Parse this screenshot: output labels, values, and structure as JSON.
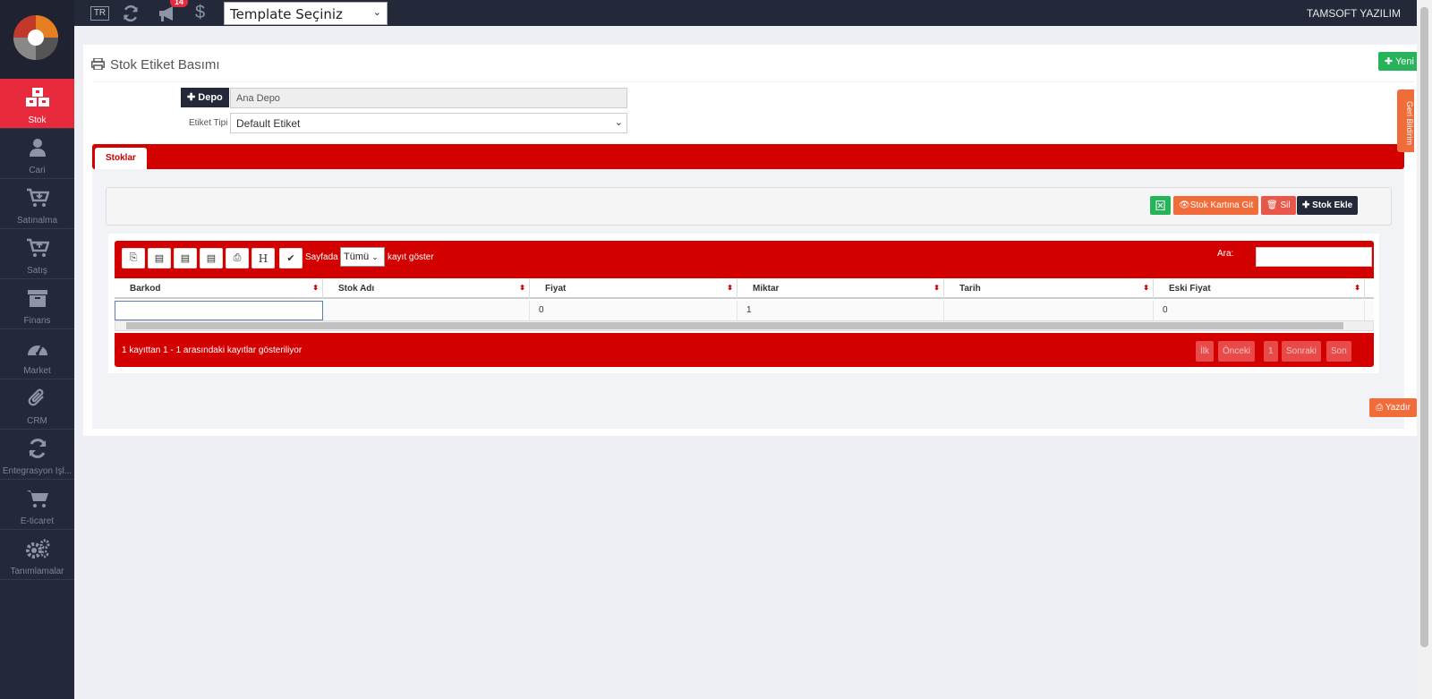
{
  "topbar": {
    "lang": "TR",
    "notification_count": "14",
    "template_select": "Template Seçiniz",
    "company": "TAMSOFT YAZILIM"
  },
  "sidebar": {
    "items": [
      {
        "label": "Stok",
        "icon": "boxes-icon"
      },
      {
        "label": "Cari",
        "icon": "user-icon"
      },
      {
        "label": "Satınalma",
        "icon": "cart-in-icon"
      },
      {
        "label": "Satış",
        "icon": "cart-out-icon"
      },
      {
        "label": "Finans",
        "icon": "archive-icon"
      },
      {
        "label": "Market",
        "icon": "dashboard-icon"
      },
      {
        "label": "CRM",
        "icon": "paperclip-icon"
      },
      {
        "label": "Entegrasyon İşl...",
        "icon": "refresh-icon"
      },
      {
        "label": "E-ticaret",
        "icon": "shopping-cart-icon"
      },
      {
        "label": "Tanımlamalar",
        "icon": "gears-icon"
      }
    ]
  },
  "page": {
    "title": "Stok Etiket Basımı",
    "new_button": "Yeni",
    "depo_button": "Depo",
    "depo_value": "Ana Depo",
    "etiket_label": "Etiket Tipi",
    "etiket_value": "Default Etiket",
    "tab": "Stoklar",
    "feedback": "Geri Bildirim",
    "print_button": "Yazdır"
  },
  "toolbar": {
    "go_to_card": "Stok Kartına Git",
    "delete": "Sil",
    "add_stock": "Stok Ekle"
  },
  "grid": {
    "show_prefix": "Sayfada",
    "page_size": "Tümü",
    "show_suffix": "kayıt göster",
    "search_label": "Ara:",
    "header_h": "H",
    "columns": [
      "Barkod",
      "Stok Adı",
      "Fiyat",
      "Miktar",
      "Tarih",
      "Eski Fiyat"
    ],
    "rows": [
      [
        "",
        "",
        "0",
        "1",
        "",
        "0"
      ]
    ],
    "info": "1 kayıttan 1 - 1 arasındaki kayıtlar gösteriliyor",
    "pager": [
      "İlk",
      "Önceki",
      "1",
      "Sonraki",
      "Son"
    ]
  },
  "colors": {
    "sidebar": "#24293a",
    "accent_red": "#d30000",
    "active_item": "#e72b3d",
    "success": "#27b35a",
    "orange": "#f06c3b"
  }
}
